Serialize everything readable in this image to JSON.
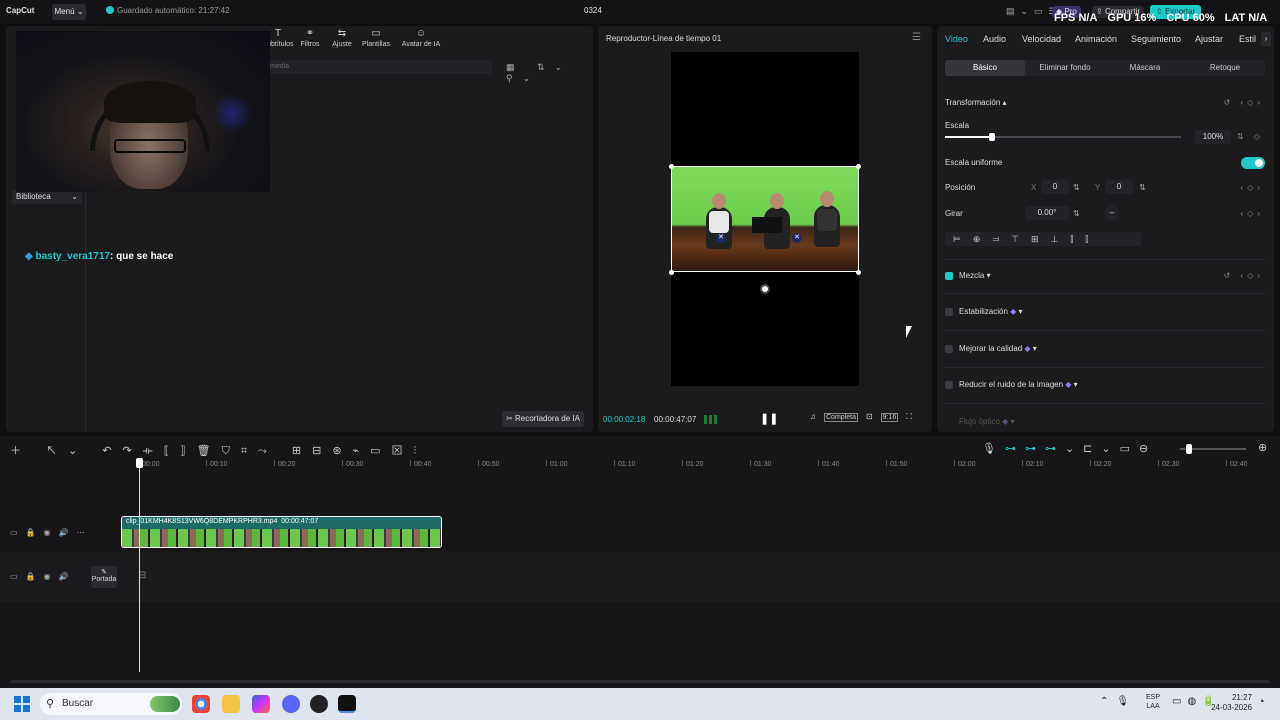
{
  "titlebar": {
    "app_name": "CapCut",
    "menu_label": "Menú",
    "autosave": "Guardado automático: 21:27:42",
    "project_title": "0324",
    "pro_label": "Pro",
    "share_label": "Compartir",
    "export_label": "Exportar",
    "stats": {
      "fps": "FPS N/A",
      "gpu": "GPU 16%",
      "cpu": "CPU 60%",
      "lat": "LAT N/A"
    },
    "window_controls": "▭ — ◻ ✕"
  },
  "left_panel": {
    "toolbar": [
      "Subtítulos",
      "Filtros",
      "Ajuste",
      "Plantillas",
      "Avatar de IA"
    ],
    "toolbar_icons": [
      "captions-icon",
      "filters-icon",
      "adjust-icon",
      "templates-icon",
      "ai-avatar-icon"
    ],
    "search_placeholder": "media",
    "library_label": "Biblioteca",
    "ai_cut_label": "Recortadora de IA",
    "chat": {
      "user": "basty_vera1717",
      "message": ": que se hace"
    }
  },
  "player": {
    "title": "Reproductor-Línea de tiempo 01",
    "time_current": "00:00:02:18",
    "time_total": "00:00:47:07",
    "quality_label": "Completa",
    "ratio_label": "9:16"
  },
  "right_panel": {
    "tabs": [
      "Video",
      "Audio",
      "Velocidad",
      "Animación",
      "Seguimiento",
      "Ajustar",
      "Estil"
    ],
    "subtabs": [
      "Básico",
      "Eliminar fondo",
      "Máscara",
      "Retoque"
    ],
    "transform_label": "Transformación",
    "scale_label": "Escala",
    "scale_value": "100%",
    "scale_slider_fraction": 0.2,
    "uniform_scale_label": "Escala uniforme",
    "position_label": "Posición",
    "pos_x_label": "X",
    "pos_x": "0",
    "pos_y_label": "Y",
    "pos_y": "0",
    "rotate_label": "Girar",
    "rotate_value": "0.00°",
    "blend_label": "Mezcla",
    "stabilization_label": "Estabilización",
    "enhance_label": "Mejorar la calidad",
    "denoise_label": "Reducir el ruido de la imagen",
    "optical_flow_label": "Flujo óptico"
  },
  "timeline": {
    "ruler": [
      "00:00",
      "00:10",
      "00:20",
      "00:30",
      "00:40",
      "00:50",
      "01:00",
      "01:10",
      "01:20",
      "01:30",
      "01:40",
      "01:50",
      "02:00",
      "02:10",
      "02:20",
      "02:30",
      "02:40"
    ],
    "clip_name": "clip_01KMH4K8S13VW6Q8DEMPKRPHR3.mp4",
    "clip_duration": "00:00:47:07",
    "cover_label": "Portada"
  },
  "taskbar": {
    "search_label": "Buscar",
    "lang_top": "ESP",
    "lang_bottom": "LAA",
    "time": "21:27",
    "date": "24-03-2026"
  },
  "colors": {
    "accent": "#20c9c9",
    "pro": "#8d7bff"
  }
}
